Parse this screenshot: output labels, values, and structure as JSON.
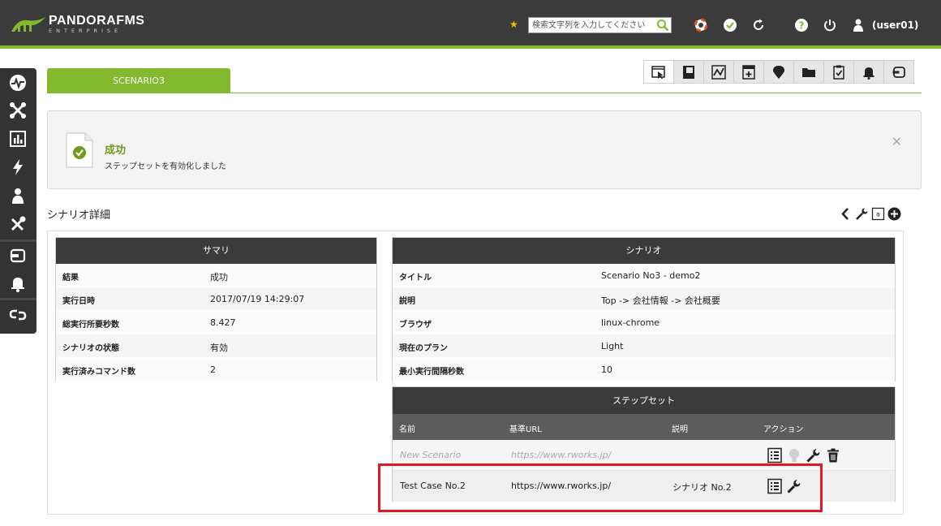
{
  "header": {
    "logo_main": "PANDORAFMS",
    "logo_sub": "ENTERPRISE",
    "search_placeholder": "検索文字列を入力してください",
    "user": "(user01)"
  },
  "tab": {
    "label": "SCENARIO3"
  },
  "success": {
    "title": "成功",
    "message": "ステップセットを有効化しました"
  },
  "section_title": "シナリオ詳細",
  "summary": {
    "title": "サマリ",
    "rows": [
      {
        "label": "結果",
        "value": "成功"
      },
      {
        "label": "実行日時",
        "value": "2017/07/19 14:29:07"
      },
      {
        "label": "総実行所要秒数",
        "value": "8.427"
      },
      {
        "label": "シナリオの状態",
        "value": "有効"
      },
      {
        "label": "実行済みコマンド数",
        "value": "2"
      }
    ]
  },
  "scenario": {
    "title": "シナリオ",
    "rows": [
      {
        "label": "タイトル",
        "value": "Scenario No3 - demo2"
      },
      {
        "label": "説明",
        "value": "Top -> 会社情報 -> 会社概要"
      },
      {
        "label": "ブラウザ",
        "value": "linux-chrome"
      },
      {
        "label": "現在のプラン",
        "value": "Light"
      },
      {
        "label": "最小実行間隔秒数",
        "value": "10"
      }
    ]
  },
  "stepset": {
    "title": "ステップセット",
    "columns": {
      "name": "名前",
      "url": "基準URL",
      "desc": "説明",
      "action": "アクション"
    },
    "rows": [
      {
        "name": "New Scenario",
        "url": "https://www.rworks.jp/",
        "desc": ""
      },
      {
        "name": "Test Case No.2",
        "url": "https://www.rworks.jp/",
        "desc": "シナリオ No.2"
      }
    ]
  },
  "colors": {
    "accent": "#82b92e",
    "dark": "#3b3b3b",
    "highlight": "#e01a22"
  }
}
